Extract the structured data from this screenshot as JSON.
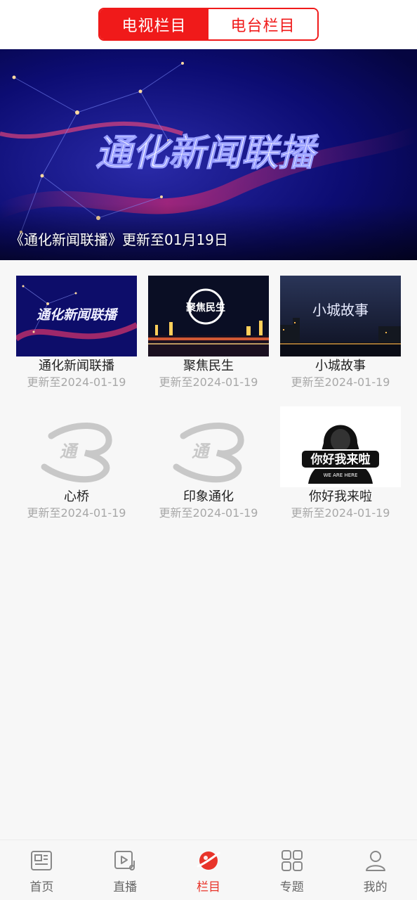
{
  "segmented": {
    "tv_label": "电视栏目",
    "radio_label": "电台栏目",
    "active": "tv"
  },
  "banner": {
    "title_overlay": "通化新闻联播",
    "caption": "《通化新闻联播》更新至01月19日"
  },
  "programs": [
    {
      "title": "通化新闻联播",
      "subtitle": "更新至2024-01-19",
      "thumb_text": "通化新闻联播"
    },
    {
      "title": "聚焦民生",
      "subtitle": "更新至2024-01-19",
      "thumb_text": "聚焦民生"
    },
    {
      "title": "小城故事",
      "subtitle": "更新至2024-01-19",
      "thumb_text": "小城故事"
    },
    {
      "title": "心桥",
      "subtitle": "更新至2024-01-19",
      "thumb_text": "通"
    },
    {
      "title": "印象通化",
      "subtitle": "更新至2024-01-19",
      "thumb_text": "通"
    },
    {
      "title": "你好我来啦",
      "subtitle": "更新至2024-01-19",
      "thumb_text": "你好我来啦",
      "thumb_subtext": "WE ARE HERE"
    }
  ],
  "tabs": [
    {
      "label": "首页",
      "icon": "news-icon"
    },
    {
      "label": "直播",
      "icon": "live-video-icon"
    },
    {
      "label": "栏目",
      "icon": "planet-icon"
    },
    {
      "label": "专题",
      "icon": "grid-icon"
    },
    {
      "label": "我的",
      "icon": "user-icon"
    }
  ],
  "colors": {
    "accent": "#f01a1a",
    "tab_active": "#e8342a",
    "subtitle_gray": "#a8a8a8"
  }
}
